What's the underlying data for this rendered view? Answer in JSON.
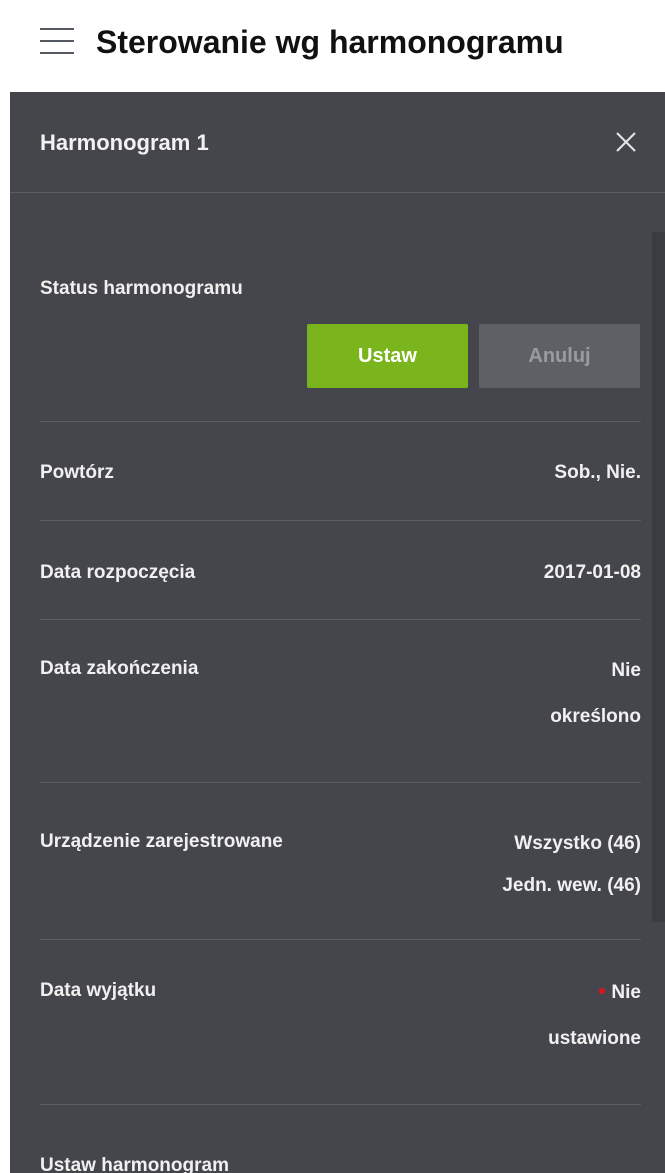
{
  "header": {
    "menu_icon": "hamburger-menu-icon",
    "title": "Sterowanie wg harmonogramu"
  },
  "panel": {
    "title": "Harmonogram 1",
    "close_icon": "close-icon"
  },
  "status": {
    "label": "Status harmonogramu",
    "set_button": "Ustaw",
    "cancel_button": "Anuluj"
  },
  "repeat": {
    "label": "Powtórz",
    "value": "Sob., Nie."
  },
  "start_date": {
    "label": "Data rozpoczęcia",
    "value": "2017-01-08"
  },
  "end_date": {
    "label": "Data zakończenia",
    "value_line1": "Nie",
    "value_line2": "określono"
  },
  "devices": {
    "label": "Urządzenie zarejestrowane",
    "value_line1": "Wszystko (46)",
    "value_line2": "Jedn. wew. (46)"
  },
  "exception_date": {
    "label": "Data wyjątku",
    "value_line1": "Nie",
    "value_line2": "ustawione"
  },
  "set_schedule": {
    "label": "Ustaw harmonogram"
  },
  "colors": {
    "panel_bg": "#45464b",
    "accent_green": "#7ab51d",
    "cancel_bg": "#5e6066",
    "indicator_red": "#e0141d"
  }
}
